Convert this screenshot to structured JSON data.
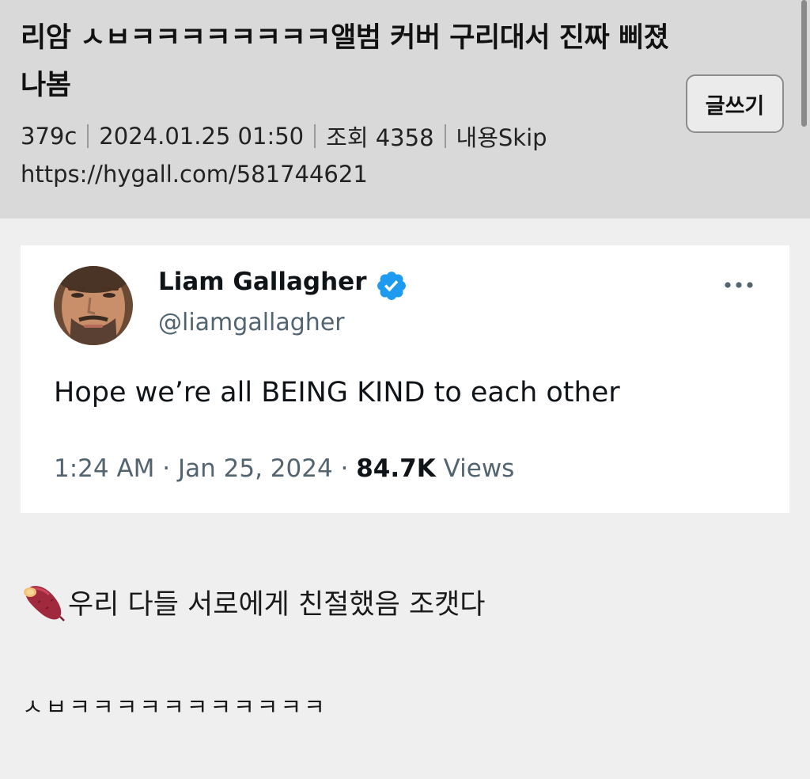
{
  "post": {
    "title": "리암 ㅅㅂㅋㅋㅋㅋㅋㅋㅋㅋ앨범 커버 구리대서 진짜 삐졌나봄",
    "write_button_label": "글쓰기",
    "comments_count": "379c",
    "datetime": "2024.01.25 01:50",
    "views_label": "조회 4358",
    "skip_label": "내용Skip",
    "url": "https://hygall.com/581744621"
  },
  "tweet": {
    "name": "Liam Gallagher",
    "handle": "@liamgallagher",
    "text": "Hope we’re all BEING KIND to each other",
    "time_date": "1:24 AM · Jan 25, 2024 · ",
    "views_count": "84.7K",
    "views_label": " Views",
    "verified_color": "#1d9bf0"
  },
  "body": {
    "line1": "우리 다들 서로에게 친절했음 조캣다",
    "line2": "ㅅㅂㅋㅋㅋㅋㅋㅋㅋㅋㅋㅋㅋ"
  },
  "icons": {
    "verified": "verified-badge-icon",
    "more": "more-horizontal-icon",
    "emoji": "sweet-potato-icon"
  }
}
